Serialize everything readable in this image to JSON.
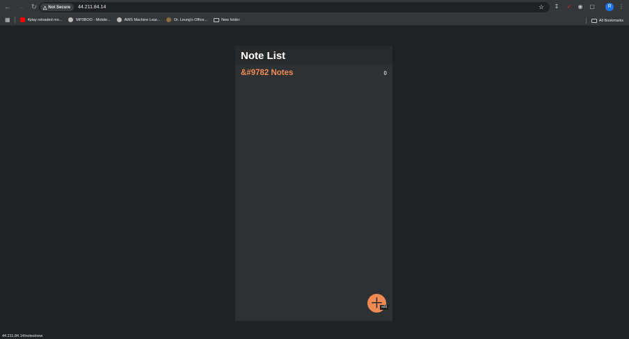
{
  "browser": {
    "security_label": "Not Secure",
    "url": "44.211.84.14",
    "avatar_letter": "R",
    "bookmarks": [
      {
        "label": "4play reloaded mo...",
        "color": "#ff0000"
      },
      {
        "label": "MP3BOO - Mobile...",
        "color": "#bdbdbd"
      },
      {
        "label": "AWS Machine Lear...",
        "color": "#bdbdbd"
      },
      {
        "label": "Dr. Leung's Office...",
        "color": "#8a6d3b"
      },
      {
        "label": "New folder",
        "color": "folder"
      }
    ],
    "all_bookmarks": "All Bookmarks"
  },
  "app": {
    "title": "Note List",
    "notes": [
      {
        "title": "&#9782 Notes",
        "count": "0"
      }
    ],
    "fab_tooltip": "add",
    "accent": "#f08a53"
  },
  "status_bar": {
    "link": "44.211.84.14/notes/new"
  }
}
